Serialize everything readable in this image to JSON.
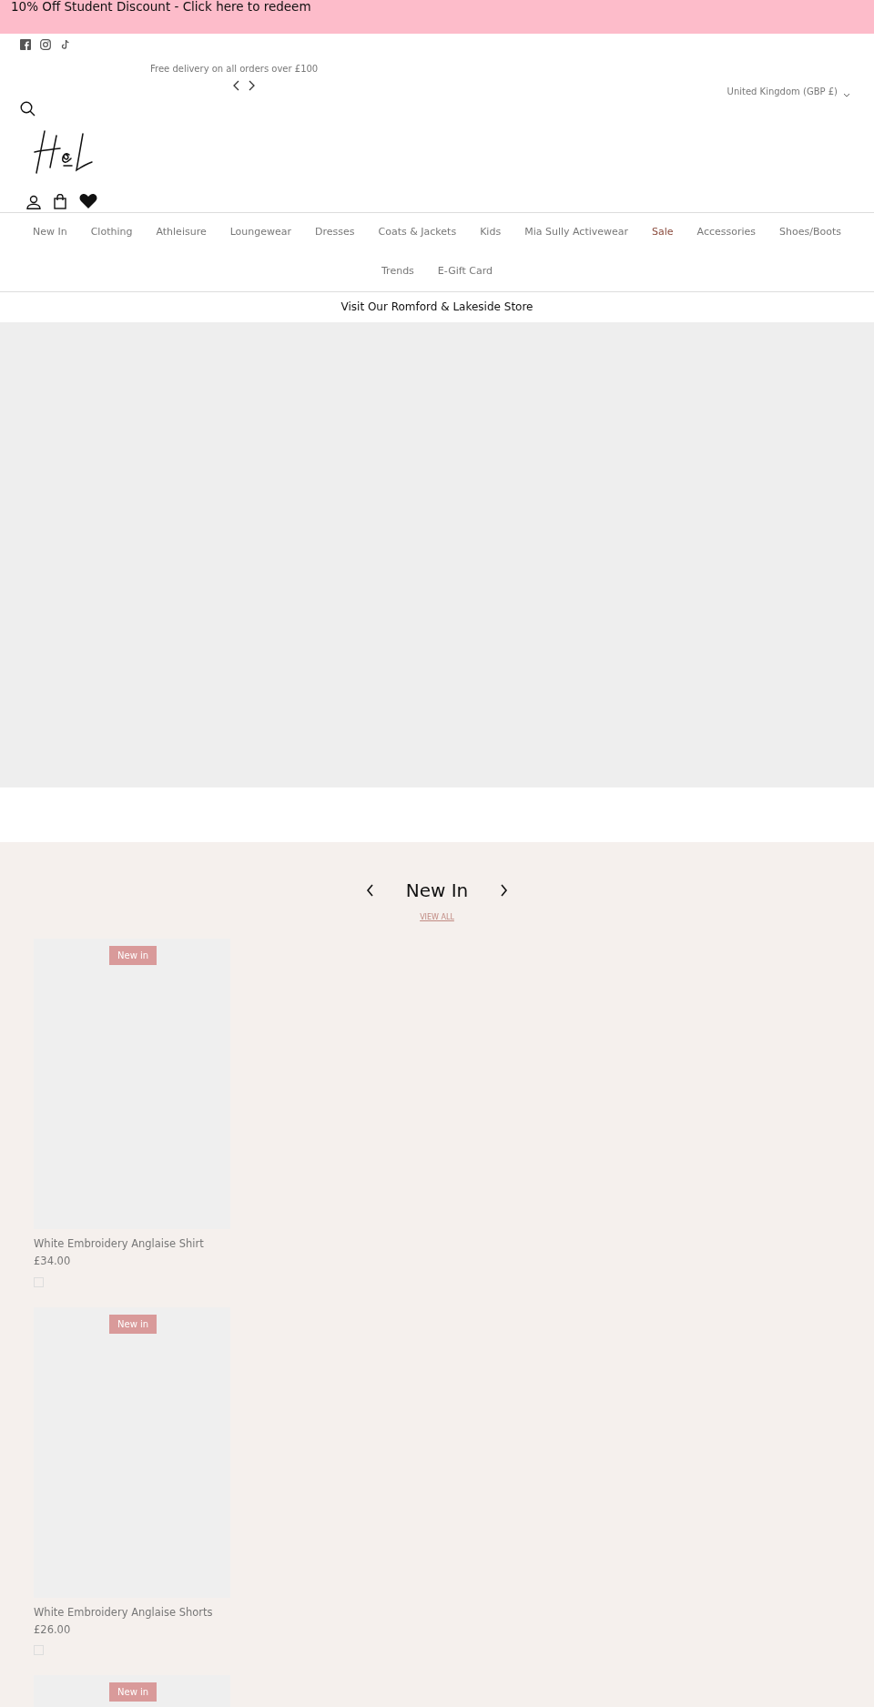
{
  "promo_banner": {
    "text": "10% Off Student Discount - Click here to redeem"
  },
  "announcement": {
    "text": "Free delivery on all orders over £100"
  },
  "country_selector": {
    "label": "United Kingdom (GBP £)"
  },
  "nav": [
    {
      "label": "New In",
      "highlighted": false
    },
    {
      "label": "Clothing",
      "highlighted": false
    },
    {
      "label": "Athleisure",
      "highlighted": false
    },
    {
      "label": "Loungewear",
      "highlighted": false
    },
    {
      "label": "Dresses",
      "highlighted": false
    },
    {
      "label": "Coats & Jackets",
      "highlighted": false
    },
    {
      "label": "Kids",
      "highlighted": false
    },
    {
      "label": "Mia Sully Activewear",
      "highlighted": false
    },
    {
      "label": "Sale",
      "highlighted": true
    },
    {
      "label": "Accessories",
      "highlighted": false
    },
    {
      "label": "Shoes/Boots",
      "highlighted": false
    },
    {
      "label": "Trends",
      "highlighted": false
    },
    {
      "label": "E-Gift Card",
      "highlighted": false
    }
  ],
  "store_bar": {
    "text": "Visit Our Romford & Lakeside Store"
  },
  "section": {
    "title": "New In",
    "link": "VIEW ALL"
  },
  "products": [
    {
      "badge": "New in",
      "title": "White Embroidery Anglaise Shirt",
      "price": "£34.00"
    },
    {
      "badge": "New in",
      "title": "White Embroidery Anglaise Shorts",
      "price": "£26.00"
    },
    {
      "badge": "New in"
    }
  ]
}
